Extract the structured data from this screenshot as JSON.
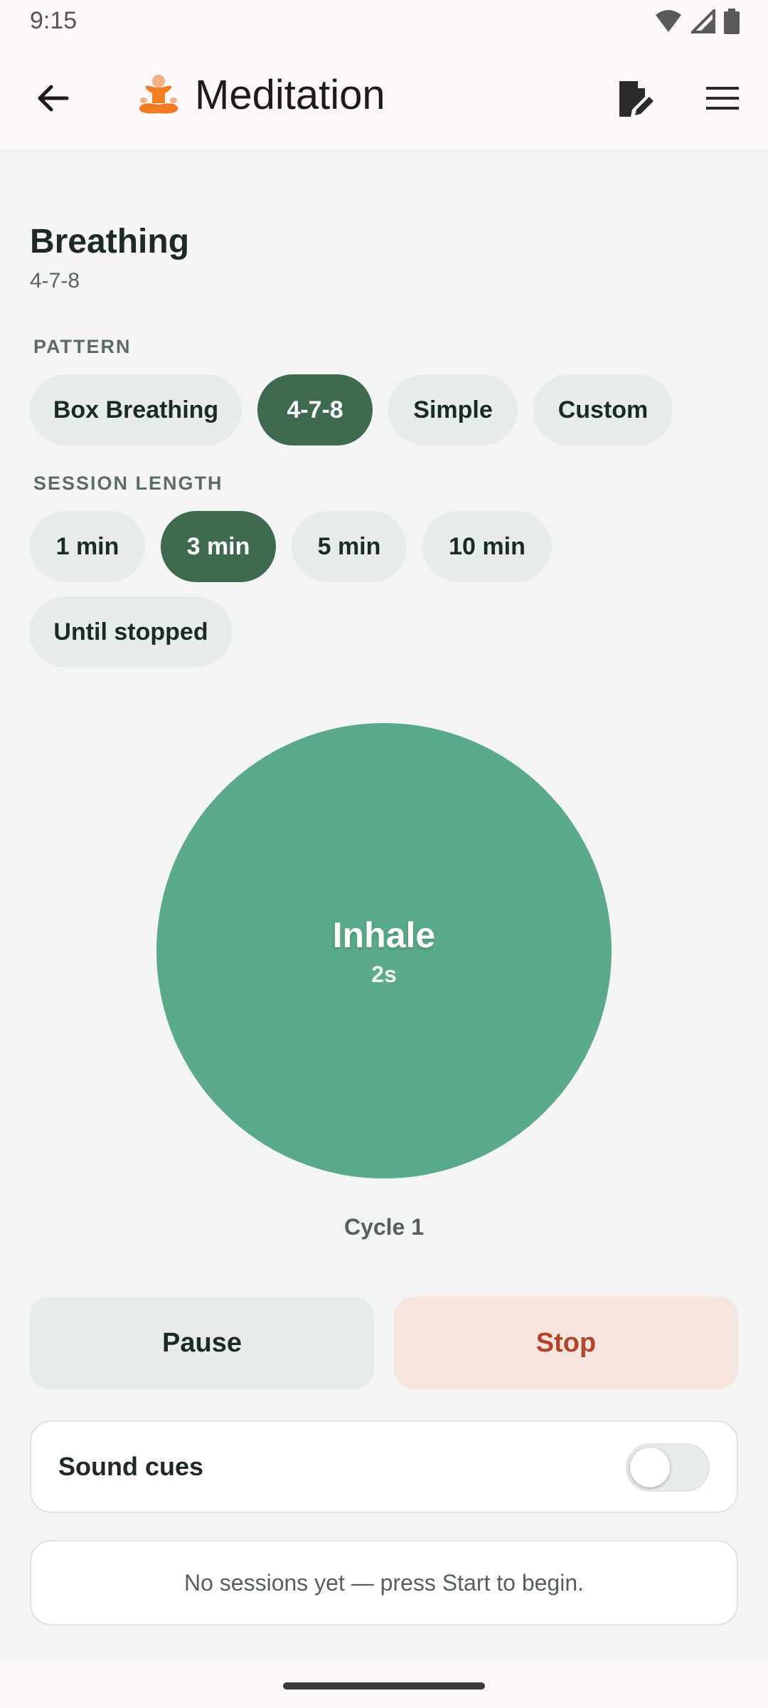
{
  "status_bar": {
    "time": "9:15",
    "icons": [
      "wifi-icon",
      "signal-icon",
      "battery-icon"
    ]
  },
  "app_bar": {
    "title": "Meditation",
    "title_icon": "meditating-person-icon",
    "actions": [
      "back-arrow-icon",
      "edit-note-icon",
      "menu-icon"
    ]
  },
  "header": {
    "title": "Breathing",
    "subtitle": "4-7-8"
  },
  "pattern": {
    "label": "PATTERN",
    "options": [
      "Box Breathing",
      "4-7-8",
      "Simple",
      "Custom"
    ],
    "selected": "4-7-8"
  },
  "session_length": {
    "label": "SESSION LENGTH",
    "options": [
      "1 min",
      "3 min",
      "5 min",
      "10 min",
      "Until stopped"
    ],
    "selected": "3 min"
  },
  "breath": {
    "phase": "Inhale",
    "seconds": "2s",
    "cycle": "Cycle 1"
  },
  "controls": {
    "pause_label": "Pause",
    "stop_label": "Stop"
  },
  "sound": {
    "label": "Sound cues",
    "enabled": false
  },
  "history": {
    "empty_text": "No sessions yet — press Start to begin."
  },
  "colors": {
    "accent": "#3e6b4f",
    "circle": "#5aaa8a",
    "stop_text": "#b5432a",
    "stop_bg": "#f6e4df",
    "chip_bg": "#e6ece9",
    "app_bar_bg": "#fdf7fb"
  }
}
